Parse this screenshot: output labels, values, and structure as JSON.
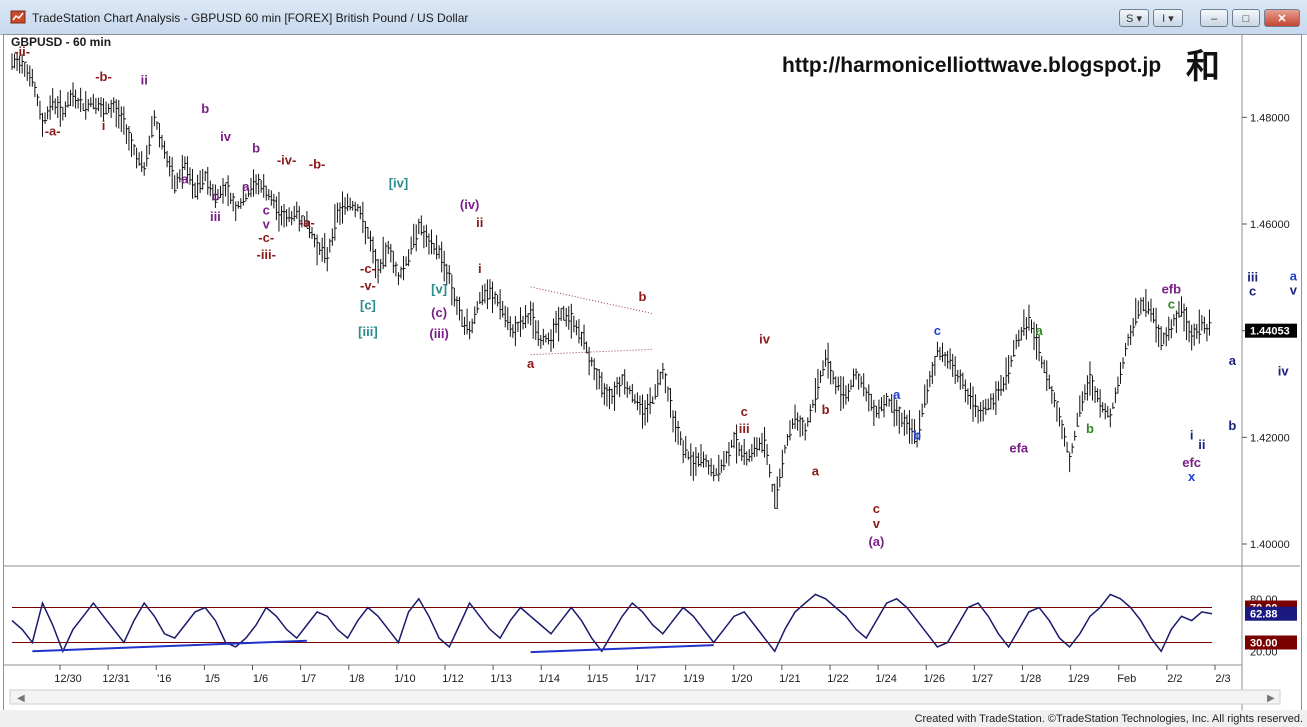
{
  "window": {
    "title": "TradeStation Chart Analysis - GBPUSD 60 min [FOREX] British Pound / US Dollar",
    "s_button": "S",
    "i_button": "I",
    "minimize_icon": "minimize-icon",
    "maximize_icon": "maximize-icon",
    "close_icon": "close-icon"
  },
  "footer": {
    "text": "Created with TradeStation. ©TradeStation Technologies, Inc. All rights reserved."
  },
  "watermark": {
    "url": "http://harmonicelliottwave.blogspot.jp",
    "kanji": "和"
  },
  "colors": {
    "darkred": "#8b1a1a",
    "purple": "#7a1f87",
    "teal": "#2a8c8c",
    "blue": "#1f3fd0",
    "navy": "#1a237e",
    "green": "#2e8b22",
    "price_box": "#000000",
    "ob_line": "#7a0000",
    "osc": "#1a1a6e"
  },
  "chart_data": [
    {
      "type": "line",
      "title": "GBPUSD - 60 min",
      "price_axis": {
        "ticks": [
          "1.48000",
          "1.46000",
          "1.44000",
          "1.42000",
          "1.40000"
        ],
        "values": [
          1.48,
          1.46,
          1.44,
          1.42,
          1.4
        ],
        "ylim": [
          1.397,
          1.493
        ],
        "last_price": "1.44053"
      },
      "date_axis": [
        "12/30",
        "12/31",
        "'16",
        "1/5",
        "1/6",
        "1/7",
        "1/8",
        "1/10",
        "1/12",
        "1/13",
        "1/14",
        "1/15",
        "1/17",
        "1/19",
        "1/20",
        "1/21",
        "1/22",
        "1/24",
        "1/26",
        "1/27",
        "1/28",
        "1/29",
        "Feb",
        "2/2",
        "2/3"
      ],
      "grid": false,
      "series": [
        {
          "values": [
            1.49,
            1.4905,
            1.487,
            1.479,
            1.483,
            1.481,
            1.484,
            1.482,
            1.483,
            1.481,
            1.482,
            1.479,
            1.474,
            1.47,
            1.48,
            1.474,
            1.467,
            1.471,
            1.466,
            1.469,
            1.465,
            1.467,
            1.463,
            1.465,
            1.468,
            1.466,
            1.463,
            1.461,
            1.462,
            1.46,
            1.456,
            1.454,
            1.462,
            1.464,
            1.463,
            1.458,
            1.451,
            1.456,
            1.45,
            1.454,
            1.46,
            1.456,
            1.455,
            1.45,
            1.443,
            1.44,
            1.446,
            1.447,
            1.445,
            1.44,
            1.441,
            1.443,
            1.438,
            1.439,
            1.443,
            1.442,
            1.439,
            1.434,
            1.429,
            1.428,
            1.431,
            1.428,
            1.425,
            1.427,
            1.433,
            1.424,
            1.418,
            1.415,
            1.416,
            1.413,
            1.415,
            1.42,
            1.416,
            1.418,
            1.419,
            1.408,
            1.418,
            1.424,
            1.421,
            1.428,
            1.435,
            1.43,
            1.428,
            1.432,
            1.428,
            1.425,
            1.427,
            1.425,
            1.422,
            1.42,
            1.429,
            1.436,
            1.435,
            1.432,
            1.428,
            1.424,
            1.426,
            1.428,
            1.433,
            1.439,
            1.442,
            1.436,
            1.43,
            1.424,
            1.416,
            1.425,
            1.431,
            1.426,
            1.424,
            1.432,
            1.44,
            1.445,
            1.444,
            1.438,
            1.441,
            1.444,
            1.439,
            1.441,
            1.44
          ]
        }
      ],
      "wave_labels": [
        {
          "text": "-ii-",
          "color": "darkred",
          "x": 1,
          "price": 1.4915
        },
        {
          "text": "-a-",
          "color": "darkred",
          "x": 4,
          "price": 1.4766
        },
        {
          "text": "-b-",
          "color": "darkred",
          "x": 9,
          "price": 1.4868
        },
        {
          "text": "i",
          "color": "darkred",
          "x": 9,
          "price": 1.4776
        },
        {
          "text": "ii",
          "color": "purple",
          "x": 13,
          "price": 1.4862
        },
        {
          "text": "b",
          "color": "purple",
          "x": 19,
          "price": 1.4808
        },
        {
          "text": "a",
          "color": "purple",
          "x": 17,
          "price": 1.4676
        },
        {
          "text": "iv",
          "color": "purple",
          "x": 21,
          "price": 1.4756
        },
        {
          "text": "c",
          "color": "purple",
          "x": 20,
          "price": 1.4644
        },
        {
          "text": "iii",
          "color": "purple",
          "x": 20,
          "price": 1.4606
        },
        {
          "text": "b",
          "color": "purple",
          "x": 24,
          "price": 1.4734
        },
        {
          "text": "a",
          "color": "purple",
          "x": 23,
          "price": 1.4662
        },
        {
          "text": "-iv-",
          "color": "darkred",
          "x": 27,
          "price": 1.4712
        },
        {
          "text": "-b-",
          "color": "darkred",
          "x": 30,
          "price": 1.4704
        },
        {
          "text": "c",
          "color": "purple",
          "x": 25,
          "price": 1.4618
        },
        {
          "text": "v",
          "color": "purple",
          "x": 25,
          "price": 1.4592
        },
        {
          "text": "-a-",
          "color": "darkred",
          "x": 29,
          "price": 1.4594
        },
        {
          "text": "-c-",
          "color": "darkred",
          "x": 25,
          "price": 1.4566
        },
        {
          "text": "-iii-",
          "color": "darkred",
          "x": 25,
          "price": 1.4534
        },
        {
          "text": "[iv]",
          "color": "teal",
          "x": 38,
          "price": 1.4668
        },
        {
          "text": "(iv)",
          "color": "purple",
          "x": 45,
          "price": 1.4628
        },
        {
          "text": "ii",
          "color": "darkred",
          "x": 46,
          "price": 1.4594
        },
        {
          "text": "-c-",
          "color": "darkred",
          "x": 35,
          "price": 1.4508
        },
        {
          "text": "-v-",
          "color": "darkred",
          "x": 35,
          "price": 1.4476
        },
        {
          "text": "i",
          "color": "darkred",
          "x": 46,
          "price": 1.4508
        },
        {
          "text": "[v]",
          "color": "teal",
          "x": 42,
          "price": 1.447
        },
        {
          "text": "[c]",
          "color": "teal",
          "x": 35,
          "price": 1.444
        },
        {
          "text": "(c)",
          "color": "purple",
          "x": 42,
          "price": 1.4426
        },
        {
          "text": "[iii]",
          "color": "teal",
          "x": 35,
          "price": 1.439
        },
        {
          "text": "(iii)",
          "color": "purple",
          "x": 42,
          "price": 1.4386
        },
        {
          "text": "b",
          "color": "darkred",
          "x": 62,
          "price": 1.4456
        },
        {
          "text": "a",
          "color": "darkred",
          "x": 51,
          "price": 1.433
        },
        {
          "text": "iv",
          "color": "darkred",
          "x": 74,
          "price": 1.4376
        },
        {
          "text": "c",
          "color": "darkred",
          "x": 72,
          "price": 1.424
        },
        {
          "text": "iii",
          "color": "darkred",
          "x": 72,
          "price": 1.4208
        },
        {
          "text": "b",
          "color": "darkred",
          "x": 80,
          "price": 1.4244
        },
        {
          "text": "a",
          "color": "darkred",
          "x": 79,
          "price": 1.4128
        },
        {
          "text": "c",
          "color": "darkred",
          "x": 85,
          "price": 1.4058
        },
        {
          "text": "v",
          "color": "darkred",
          "x": 85,
          "price": 1.403
        },
        {
          "text": "(a)",
          "color": "purple",
          "x": 85,
          "price": 1.3996
        },
        {
          "text": "a",
          "color": "blue",
          "x": 87,
          "price": 1.4272
        },
        {
          "text": "b",
          "color": "blue",
          "x": 89,
          "price": 1.4196
        },
        {
          "text": "c",
          "color": "blue",
          "x": 91,
          "price": 1.4392
        },
        {
          "text": "efa",
          "color": "purple",
          "x": 99,
          "price": 1.4172
        },
        {
          "text": "a",
          "color": "green",
          "x": 101,
          "price": 1.4392
        },
        {
          "text": "b",
          "color": "green",
          "x": 106,
          "price": 1.4208
        },
        {
          "text": "efb",
          "color": "purple",
          "x": 114,
          "price": 1.447
        },
        {
          "text": "c",
          "color": "green",
          "x": 114,
          "price": 1.4442
        },
        {
          "text": "i",
          "color": "navy",
          "x": 116,
          "price": 1.4196
        },
        {
          "text": "ii",
          "color": "navy",
          "x": 117,
          "price": 1.4178
        },
        {
          "text": "efc",
          "color": "purple",
          "x": 116,
          "price": 1.4144
        },
        {
          "text": "x",
          "color": "blue",
          "x": 116,
          "price": 1.4118
        },
        {
          "text": "a",
          "color": "navy",
          "x": 120,
          "price": 1.4336
        },
        {
          "text": "b",
          "color": "navy",
          "x": 120,
          "price": 1.4214
        },
        {
          "text": "iii",
          "color": "navy",
          "x": 122,
          "price": 1.4492
        },
        {
          "text": "c",
          "color": "navy",
          "x": 122,
          "price": 1.4466
        },
        {
          "text": "a",
          "color": "blue",
          "x": 126,
          "price": 1.4494
        },
        {
          "text": "v",
          "color": "navy",
          "x": 126,
          "price": 1.4468
        },
        {
          "text": "iv",
          "color": "navy",
          "x": 125,
          "price": 1.4316
        }
      ]
    },
    {
      "type": "line",
      "oscillator_axis": {
        "ticks": [
          "80.00",
          "20.00"
        ],
        "values": [
          80,
          20
        ],
        "levels": [
          "70.00",
          "30.00"
        ],
        "level_values": [
          70,
          30
        ],
        "ylim": [
          10,
          90
        ],
        "last_value": "62.88"
      },
      "series": [
        {
          "values": [
            55,
            45,
            30,
            75,
            50,
            20,
            45,
            60,
            75,
            60,
            45,
            30,
            55,
            75,
            60,
            40,
            35,
            50,
            65,
            70,
            55,
            30,
            25,
            35,
            50,
            70,
            60,
            45,
            35,
            50,
            65,
            60,
            45,
            35,
            55,
            70,
            60,
            45,
            30,
            65,
            80,
            60,
            35,
            25,
            50,
            75,
            60,
            45,
            35,
            55,
            70,
            60,
            50,
            40,
            55,
            70,
            55,
            35,
            20,
            40,
            60,
            75,
            65,
            50,
            40,
            55,
            70,
            60,
            45,
            30,
            45,
            60,
            65,
            50,
            35,
            20,
            45,
            65,
            75,
            85,
            80,
            70,
            60,
            45,
            35,
            55,
            75,
            80,
            70,
            55,
            40,
            25,
            30,
            50,
            70,
            75,
            60,
            40,
            25,
            45,
            65,
            70,
            55,
            35,
            25,
            40,
            60,
            70,
            85,
            80,
            70,
            55,
            35,
            20,
            45,
            60,
            55,
            65,
            62.88
          ]
        }
      ],
      "trendlines": 3
    }
  ]
}
